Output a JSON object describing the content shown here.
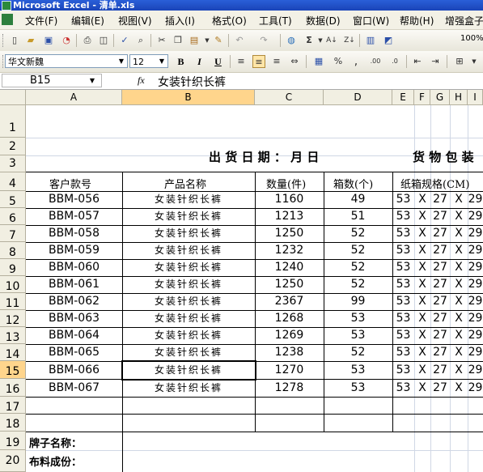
{
  "window": {
    "title": "Microsoft Excel - 清单.xls"
  },
  "menu": {
    "items": [
      "文件(F)",
      "编辑(E)",
      "视图(V)",
      "插入(I)",
      "格式(O)",
      "工具(T)",
      "数据(D)",
      "窗口(W)",
      "帮助(H)",
      "增强盒子"
    ]
  },
  "toolbar": {
    "font_name": "华文新魏",
    "font_size": "12",
    "zoom": "100%",
    "bold": "B",
    "italic": "I",
    "underline": "U",
    "percent": "%",
    "comma": ","
  },
  "formula_bar": {
    "cell_ref": "B15",
    "fx": "fx",
    "content": "女装针织长裤"
  },
  "columns": [
    "A",
    "B",
    "C",
    "D",
    "E",
    "F",
    "G",
    "H",
    "I"
  ],
  "rows": [
    "1",
    "2",
    "3",
    "4",
    "5",
    "6",
    "7",
    "8",
    "9",
    "10",
    "11",
    "12",
    "13",
    "14",
    "15",
    "16",
    "17",
    "18",
    "19",
    "20"
  ],
  "sheet": {
    "ship_date": "出 货 日 期 ：   月 日",
    "title_right": "货 物 包 装",
    "headers": {
      "customer_no": "客户款号",
      "product_name": "产品名称",
      "qty": "数量(件)",
      "boxes": "箱数(个)",
      "carton": "纸箱规格(CM)"
    },
    "data": [
      {
        "code": "BBM-056",
        "name": "女装针织长裤",
        "qty": "1160",
        "boxes": "49",
        "l": "53",
        "x1": "X",
        "w": "27",
        "x2": "X",
        "h": "29"
      },
      {
        "code": "BBM-057",
        "name": "女装针织长裤",
        "qty": "1213",
        "boxes": "51",
        "l": "53",
        "x1": "X",
        "w": "27",
        "x2": "X",
        "h": "29"
      },
      {
        "code": "BBM-058",
        "name": "女装针织长裤",
        "qty": "1250",
        "boxes": "52",
        "l": "53",
        "x1": "X",
        "w": "27",
        "x2": "X",
        "h": "29"
      },
      {
        "code": "BBM-059",
        "name": "女装针织长裤",
        "qty": "1232",
        "boxes": "52",
        "l": "53",
        "x1": "X",
        "w": "27",
        "x2": "X",
        "h": "29"
      },
      {
        "code": "BBM-060",
        "name": "女装针织长裤",
        "qty": "1240",
        "boxes": "52",
        "l": "53",
        "x1": "X",
        "w": "27",
        "x2": "X",
        "h": "29"
      },
      {
        "code": "BBM-061",
        "name": "女装针织长裤",
        "qty": "1250",
        "boxes": "52",
        "l": "53",
        "x1": "X",
        "w": "27",
        "x2": "X",
        "h": "29"
      },
      {
        "code": "BBM-062",
        "name": "女装针织长裤",
        "qty": "2367",
        "boxes": "99",
        "l": "53",
        "x1": "X",
        "w": "27",
        "x2": "X",
        "h": "29"
      },
      {
        "code": "BBM-063",
        "name": "女装针织长裤",
        "qty": "1268",
        "boxes": "53",
        "l": "53",
        "x1": "X",
        "w": "27",
        "x2": "X",
        "h": "29"
      },
      {
        "code": "BBM-064",
        "name": "女装针织长裤",
        "qty": "1269",
        "boxes": "53",
        "l": "53",
        "x1": "X",
        "w": "27",
        "x2": "X",
        "h": "29"
      },
      {
        "code": "BBM-065",
        "name": "女装针织长裤",
        "qty": "1238",
        "boxes": "52",
        "l": "53",
        "x1": "X",
        "w": "27",
        "x2": "X",
        "h": "29"
      },
      {
        "code": "BBM-066",
        "name": "女装针织长裤",
        "qty": "1270",
        "boxes": "53",
        "l": "53",
        "x1": "X",
        "w": "27",
        "x2": "X",
        "h": "29"
      },
      {
        "code": "BBM-067",
        "name": "女装针织长裤",
        "qty": "1278",
        "boxes": "53",
        "l": "53",
        "x1": "X",
        "w": "27",
        "x2": "X",
        "h": "29"
      }
    ],
    "brand_label": "牌子名称：",
    "fabric_label": "布料成份："
  },
  "colors": {
    "title_bar": "#1a44b8",
    "header_bg": "#f1efe2",
    "selected_header": "#ffd58c",
    "gridline": "#d0d7e5"
  }
}
